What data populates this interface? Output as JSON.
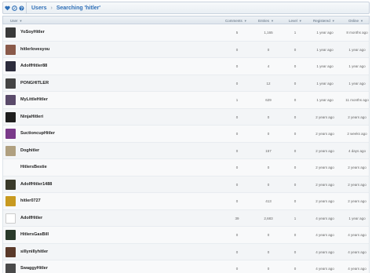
{
  "breadcrumb": {
    "root": "Users",
    "separator": "›",
    "current": "Searching 'hitler'"
  },
  "icons": [
    "heart-icon",
    "compass-icon",
    "help-icon"
  ],
  "columns": [
    "User",
    "Comments",
    "Entries",
    "Level",
    "Registered",
    "Online"
  ],
  "rows": [
    {
      "user": "YoSoyHitler",
      "comments": "5",
      "entries": "1,165",
      "level": "1",
      "registered": "1 year ago",
      "online": "8 months ago",
      "avatar": "#3a3a3a"
    },
    {
      "user": "hitlerlovesyou",
      "comments": "0",
      "entries": "0",
      "level": "0",
      "registered": "1 year ago",
      "online": "1 year ago",
      "avatar": "#8a5a4a"
    },
    {
      "user": "AdolfHitler88",
      "comments": "0",
      "entries": "4",
      "level": "0",
      "registered": "1 year ago",
      "online": "1 year ago",
      "avatar": "#2c2c3c"
    },
    {
      "user": "PONGHITLER",
      "comments": "0",
      "entries": "12",
      "level": "0",
      "registered": "1 year ago",
      "online": "1 year ago",
      "avatar": "#444444"
    },
    {
      "user": "MyLittleHitler",
      "comments": "1",
      "entries": "629",
      "level": "0",
      "registered": "1 year ago",
      "online": "11 months ago",
      "avatar": "#5a4a6a"
    },
    {
      "user": "NinjaHitleri",
      "comments": "0",
      "entries": "0",
      "level": "0",
      "registered": "2 years ago",
      "online": "2 years ago",
      "avatar": "#1e1e1e"
    },
    {
      "user": "SuctioncupHitler",
      "comments": "0",
      "entries": "0",
      "level": "0",
      "registered": "2 years ago",
      "online": "2 weeks ago",
      "avatar": "#7a3a8a"
    },
    {
      "user": "Doghitler",
      "comments": "0",
      "entries": "157",
      "level": "0",
      "registered": "2 years ago",
      "online": "4 days ago",
      "avatar": "#b0a080"
    },
    {
      "user": "HitlersBestie",
      "comments": "0",
      "entries": "0",
      "level": "0",
      "registered": "2 years ago",
      "online": "2 years ago",
      "avatar": "none"
    },
    {
      "user": "AdolfHitler1488",
      "comments": "0",
      "entries": "0",
      "level": "0",
      "registered": "2 years ago",
      "online": "2 years ago",
      "avatar": "#3a3a2a"
    },
    {
      "user": "hitler0727",
      "comments": "0",
      "entries": "413",
      "level": "0",
      "registered": "2 years ago",
      "online": "2 years ago",
      "avatar": "#c89a20"
    },
    {
      "user": "AdolfHitler",
      "comments": "39",
      "entries": "2,683",
      "level": "1",
      "registered": "4 years ago",
      "online": "1 year ago",
      "avatar": "#ffffff"
    },
    {
      "user": "HitlersGasBill",
      "comments": "0",
      "entries": "0",
      "level": "0",
      "registered": "4 years ago",
      "online": "4 years ago",
      "avatar": "#2a3a2a"
    },
    {
      "user": "sillynillyhitler",
      "comments": "0",
      "entries": "0",
      "level": "0",
      "registered": "4 years ago",
      "online": "4 years ago",
      "avatar": "#5a3a2a"
    },
    {
      "user": "SwaggyHitler",
      "comments": "0",
      "entries": "0",
      "level": "0",
      "registered": "4 years ago",
      "online": "4 years ago",
      "avatar": "#4a4a4a"
    }
  ]
}
